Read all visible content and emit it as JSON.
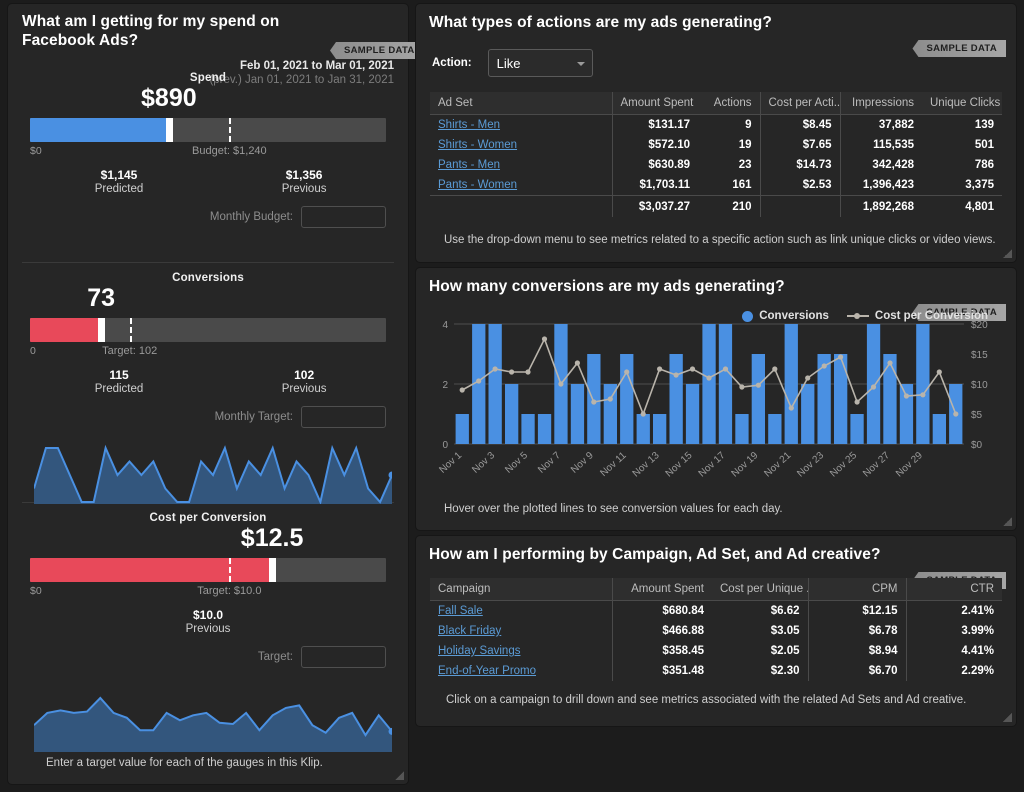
{
  "left": {
    "title": "What am I getting for my spend on Facebook Ads?",
    "sample_badge": "SAMPLE DATA",
    "date_range": "Feb 01, 2021 to  Mar 01, 2021",
    "date_prev": "(prev.) Jan 01, 2021 to  Jan 31, 2021",
    "hint": "Enter a target value for each of the gauges in this Klip.",
    "gauges": [
      {
        "label": "Spend",
        "value": "$890",
        "value_pct": 39,
        "fill_color": "#4a90e2",
        "min_label": "$0",
        "target_label": "Budget: $1,240",
        "target_pct": 56,
        "show_target_line": true,
        "compare": [
          {
            "num": "$1,145",
            "label": "Predicted",
            "pos_pct": 25
          },
          {
            "num": "$1,356",
            "label": "Previous",
            "pos_pct": 77
          }
        ],
        "input_label": "Monthly Budget:",
        "input_value": ""
      },
      {
        "label": "Conversions",
        "value": "73",
        "value_pct": 20,
        "fill_color": "#e8495a",
        "min_label": "0",
        "target_label": "Target: 102",
        "target_pct": 28,
        "show_target_line": true,
        "compare": [
          {
            "num": "115",
            "label": "Predicted",
            "pos_pct": 25
          },
          {
            "num": "102",
            "label": "Previous",
            "pos_pct": 77
          }
        ],
        "input_label": "Monthly Target:",
        "input_value": ""
      },
      {
        "label": "Cost per Conversion",
        "value": "$12.5",
        "value_pct": 68,
        "fill_color": "#e8495a",
        "min_label": "$0",
        "target_label": "Target: $10.0",
        "target_pct": 56,
        "show_target_line": true,
        "compare": [
          {
            "num": "$10.0",
            "label": "Previous",
            "pos_pct": 50
          }
        ],
        "input_label": "Target:",
        "input_value": ""
      }
    ],
    "sparkline_conversions": [
      1,
      4,
      4,
      2,
      0,
      0,
      4,
      2,
      3,
      2,
      3,
      1,
      0,
      0,
      3,
      2,
      4,
      1,
      3,
      2,
      4,
      1,
      3,
      2,
      0,
      4,
      2,
      4,
      1,
      0,
      2
    ],
    "sparkline_cost": [
      2,
      3,
      3.2,
      3,
      3.1,
      4.2,
      3,
      2.6,
      1.6,
      1.6,
      3,
      2.4,
      2.8,
      3,
      2.2,
      2.1,
      3,
      1.6,
      2.8,
      3.4,
      3.6,
      2,
      1.4,
      2.6,
      3,
      1.2,
      2.8,
      1.5
    ]
  },
  "actions": {
    "title": "What types of actions are my ads generating?",
    "sample_badge": "SAMPLE DATA",
    "action_label": "Action:",
    "action_value": "Like",
    "columns": [
      "Ad Set",
      "Amount Spent",
      "Actions",
      "Cost per Acti...",
      "Impressions",
      "Unique Clicks"
    ],
    "rows": [
      {
        "ad_set": "Shirts - Men",
        "amount_spent": "$131.17",
        "actions": "9",
        "cost_per_action": "$8.45",
        "impressions": "37,882",
        "unique_clicks": "139"
      },
      {
        "ad_set": "Shirts - Women",
        "amount_spent": "$572.10",
        "actions": "19",
        "cost_per_action": "$7.65",
        "impressions": "115,535",
        "unique_clicks": "501"
      },
      {
        "ad_set": "Pants - Men",
        "amount_spent": "$630.89",
        "actions": "23",
        "cost_per_action": "$14.73",
        "impressions": "342,428",
        "unique_clicks": "786"
      },
      {
        "ad_set": "Pants - Women",
        "amount_spent": "$1,703.11",
        "actions": "161",
        "cost_per_action": "$2.53",
        "impressions": "1,396,423",
        "unique_clicks": "3,375"
      }
    ],
    "total": {
      "ad_set": "",
      "amount_spent": "$3,037.27",
      "actions": "210",
      "cost_per_action": "",
      "impressions": "1,892,268",
      "unique_clicks": "4,801"
    },
    "footer": "Use the drop-down menu to see metrics related to a specific action such as link unique clicks or video views."
  },
  "conversions_panel": {
    "title": "How many conversions are my ads generating?",
    "sample_badge": "SAMPLE DATA",
    "footer": "Hover over the plotted lines to see conversion values for each day."
  },
  "campaigns": {
    "title": "How am I performing by Campaign, Ad Set, and Ad creative?",
    "sample_badge": "SAMPLE DATA",
    "columns": [
      "Campaign",
      "Amount Spent",
      "Cost per Unique ...",
      "CPM",
      "CTR"
    ],
    "rows": [
      {
        "campaign": "Fall Sale",
        "amount_spent": "$680.84",
        "cost_per_unique": "$6.62",
        "cpm": "$12.15",
        "ctr": "2.41%"
      },
      {
        "campaign": "Black Friday",
        "amount_spent": "$466.88",
        "cost_per_unique": "$3.05",
        "cpm": "$6.78",
        "ctr": "3.99%"
      },
      {
        "campaign": "Holiday Savings",
        "amount_spent": "$358.45",
        "cost_per_unique": "$2.05",
        "cpm": "$8.94",
        "ctr": "4.41%"
      },
      {
        "campaign": "End-of-Year Promo",
        "amount_spent": "$351.48",
        "cost_per_unique": "$2.30",
        "cpm": "$6.70",
        "ctr": "2.29%"
      }
    ],
    "footer": "Click on a campaign to drill down and see metrics associated with the related Ad Sets and Ad creative."
  },
  "chart_data": {
    "type": "bar",
    "title": "How many conversions are my ads generating?",
    "xlabel": "",
    "ylabel": "Conversions",
    "y2label": "Cost per Conversion",
    "ylim": [
      0,
      4
    ],
    "y2lim": [
      0,
      20
    ],
    "yticks": [
      0,
      2,
      4
    ],
    "y2ticks": [
      "$0",
      "$5",
      "$10",
      "$15",
      "$20"
    ],
    "grid": true,
    "legend": [
      "Conversions",
      "Cost per Conversion"
    ],
    "legend_position": "top-right",
    "categories": [
      "Nov 1",
      "Nov 2",
      "Nov 3",
      "Nov 4",
      "Nov 5",
      "Nov 6",
      "Nov 7",
      "Nov 8",
      "Nov 9",
      "Nov 10",
      "Nov 11",
      "Nov 12",
      "Nov 13",
      "Nov 14",
      "Nov 15",
      "Nov 16",
      "Nov 17",
      "Nov 18",
      "Nov 19",
      "Nov 20",
      "Nov 21",
      "Nov 22",
      "Nov 23",
      "Nov 24",
      "Nov 25",
      "Nov 26",
      "Nov 27",
      "Nov 28",
      "Nov 29",
      "Nov 30"
    ],
    "tick_labels": [
      "Nov 1",
      "Nov 3",
      "Nov 5",
      "Nov 7",
      "Nov 9",
      "Nov 11",
      "Nov 13",
      "Nov 15",
      "Nov 17",
      "Nov 19",
      "Nov 21",
      "Nov 23",
      "Nov 25",
      "Nov 27",
      "Nov 29"
    ],
    "series": [
      {
        "name": "Conversions",
        "type": "bar",
        "color": "#4a90e2",
        "axis": "left",
        "values": [
          1,
          4,
          4,
          2,
          1,
          1,
          4,
          2,
          3,
          2,
          3,
          1,
          1,
          3,
          2,
          4,
          4,
          1,
          3,
          1,
          4,
          2,
          3,
          3,
          1,
          4,
          3,
          2,
          4,
          1,
          2
        ]
      },
      {
        "name": "Cost per Conversion",
        "type": "line",
        "color": "#b9b4ab",
        "axis": "right",
        "values": [
          9,
          10.5,
          12.5,
          12,
          12,
          17.5,
          10,
          13.5,
          7,
          7.5,
          12,
          5,
          12.5,
          11.5,
          12.5,
          11,
          12.5,
          9.5,
          9.8,
          12.5,
          6,
          11,
          13,
          14.5,
          7,
          9.5,
          13.5,
          8,
          8.2,
          12,
          5
        ]
      }
    ]
  }
}
